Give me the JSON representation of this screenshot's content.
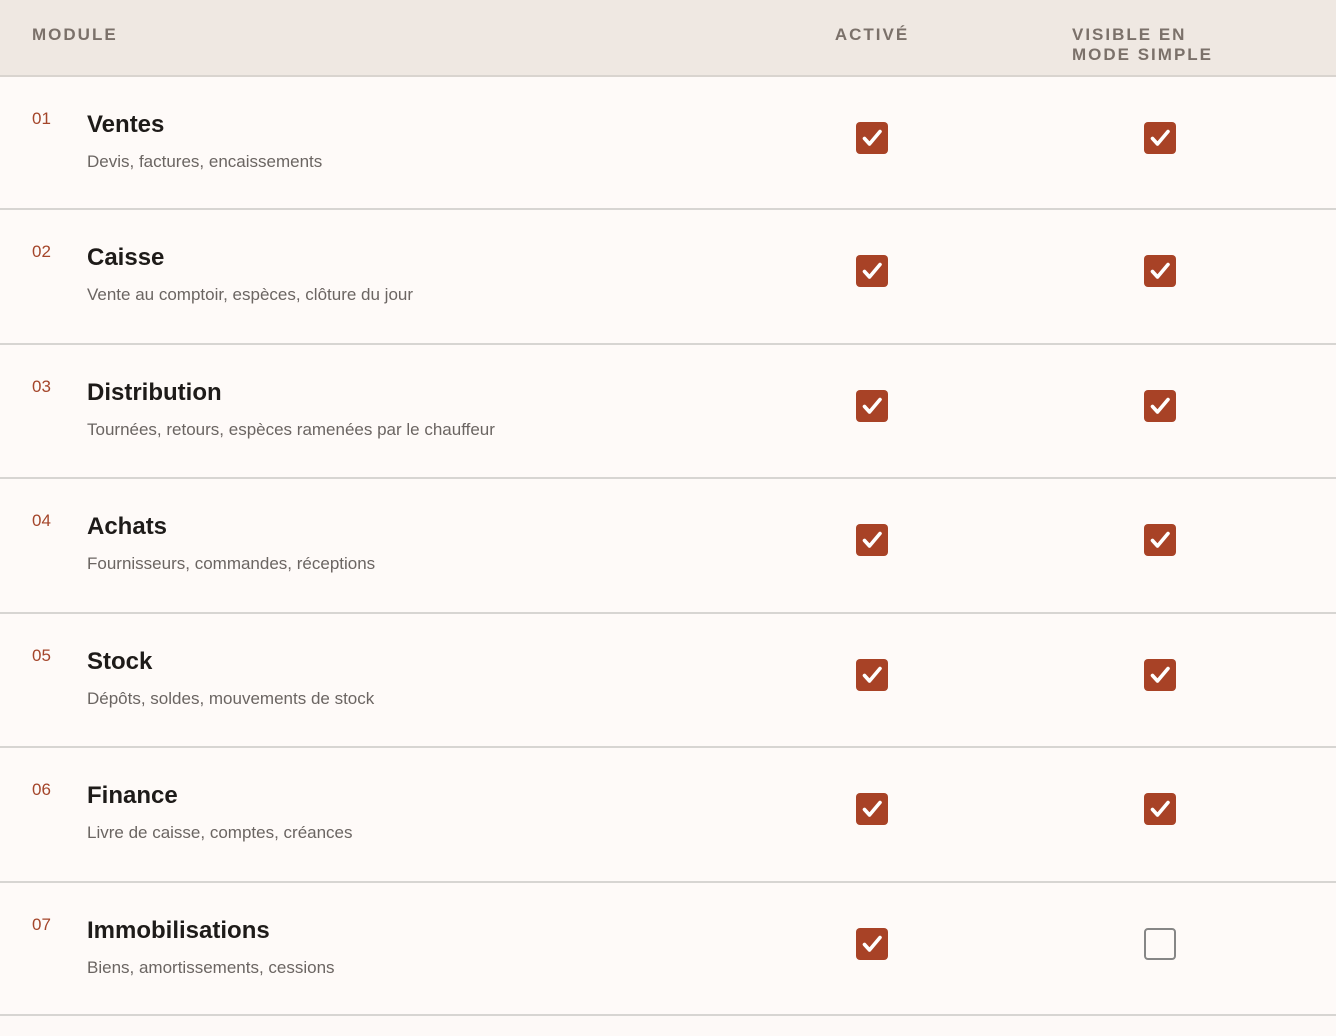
{
  "header": {
    "module": "MODULE",
    "active": "ACTIVÉ",
    "visible": "VISIBLE EN MODE SIMPLE"
  },
  "rows": [
    {
      "num": "01",
      "title": "Ventes",
      "desc": "Devis, factures, encaissements",
      "active": true,
      "visible": true
    },
    {
      "num": "02",
      "title": "Caisse",
      "desc": "Vente au comptoir, espèces, clôture du jour",
      "active": true,
      "visible": true
    },
    {
      "num": "03",
      "title": "Distribution",
      "desc": "Tournées, retours, espèces ramenées par le chauffeur",
      "active": true,
      "visible": true
    },
    {
      "num": "04",
      "title": "Achats",
      "desc": "Fournisseurs, commandes, réceptions",
      "active": true,
      "visible": true
    },
    {
      "num": "05",
      "title": "Stock",
      "desc": "Dépôts, soldes, mouvements de stock",
      "active": true,
      "visible": true
    },
    {
      "num": "06",
      "title": "Finance",
      "desc": "Livre de caisse, comptes, créances",
      "active": true,
      "visible": true
    },
    {
      "num": "07",
      "title": "Immobilisations",
      "desc": "Biens, amortissements, cessions",
      "active": true,
      "visible": false
    }
  ],
  "colors": {
    "accent": "#a84226",
    "number": "#a4452a"
  },
  "icons": {
    "checked": "checkbox-checked-icon",
    "unchecked": "checkbox-empty-icon"
  }
}
